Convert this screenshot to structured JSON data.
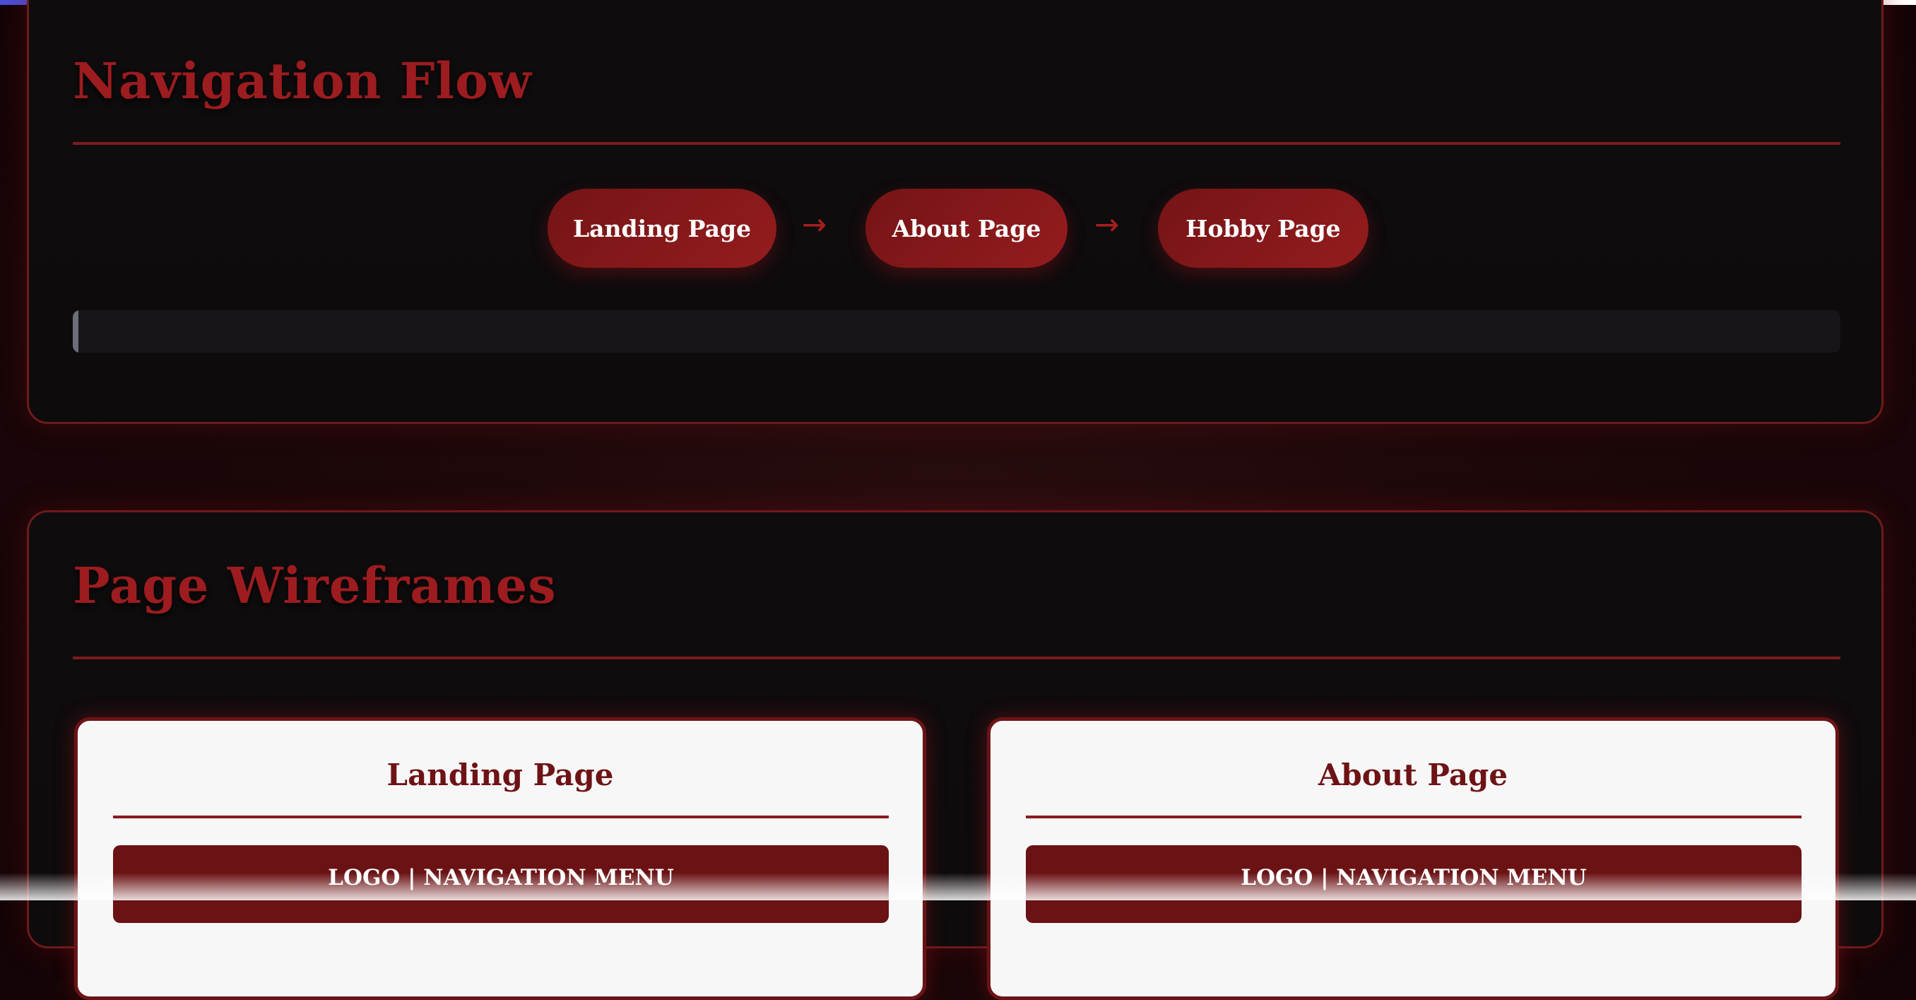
{
  "navigation_flow": {
    "title": "Navigation Flow",
    "steps": [
      {
        "label": "Landing Page"
      },
      {
        "label": "About Page"
      },
      {
        "label": "Hobby Page"
      }
    ],
    "arrow": "→",
    "code_line": ""
  },
  "page_wireframes": {
    "title": "Page Wireframes",
    "cards": [
      {
        "title": "Landing Page",
        "nav_bar": "LOGO | NAVIGATION MENU"
      },
      {
        "title": "About Page",
        "nav_bar": "LOGO | NAVIGATION MENU"
      }
    ]
  },
  "colors": {
    "accent": "#9c1c1f",
    "pill": "#861a1c",
    "card_background": "#0f0c0e",
    "wireframe_background": "#f7f7f8"
  }
}
